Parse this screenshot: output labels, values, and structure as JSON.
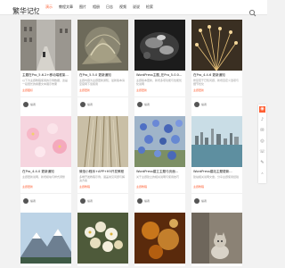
{
  "header": {
    "logo_text": "繁华记忆",
    "nav": [
      "演示",
      "教程文章",
      "图片",
      "相册",
      "日志",
      "视频",
      "说说",
      "检索"
    ],
    "active_index": 0
  },
  "colors": {
    "accent": "#ff5f33",
    "text": "#222222",
    "muted": "#999999",
    "background": "#f2f2f2"
  },
  "cards": [
    {
      "title": "主题在Pro_5.6.2+移动端框架...",
      "excerpt": "以下为主题教程使用的示例数据，这是一段很长的摘要文本展示效果",
      "tag": "主题图标",
      "author": "编者"
    },
    {
      "title": "在Pro_5.5.0 更新通知",
      "excerpt": "主题内容为主题更新通知，最新版本请至官网下载使用",
      "tag": "主题更新",
      "author": "编者"
    },
    {
      "title": "WordPress主题_在Pro_5.0.0...",
      "excerpt": "主题版本更新，新增多项功能与性能优化说明",
      "tag": "主题更新",
      "author": "编者"
    },
    {
      "title": "在Pro_4.4.6 更新通知",
      "excerpt": "修复若干已知问题，新增自定义选项与细节优化",
      "tag": "主题更新",
      "author": "编者"
    },
    {
      "title": "在Pro_4.4.0 更新通知",
      "excerpt": "主题更新说明，新增模块与样式调整",
      "tag": "主题更新",
      "author": "编者"
    },
    {
      "title": "微信小程序+APP+H5开发教程",
      "excerpt": "多端开发教程示例，涵盖常见问题与解决方案",
      "tag": "主题教程",
      "author": "编者"
    },
    {
      "title": "WordPress建立主题与页面...",
      "excerpt": "关于主题建立的相关说明与使用技巧",
      "tag": "主题教程",
      "author": "编者"
    },
    {
      "title": "WordPress建站主题更新...",
      "excerpt": "建站相关说明文章，分享主题使用经验",
      "tag": "主题教程",
      "author": "编者"
    },
    {
      "title": "",
      "excerpt": "",
      "tag": "",
      "author": ""
    },
    {
      "title": "",
      "excerpt": "",
      "tag": "",
      "author": ""
    },
    {
      "title": "",
      "excerpt": "",
      "tag": "",
      "author": ""
    },
    {
      "title": "",
      "excerpt": "",
      "tag": "",
      "author": ""
    }
  ],
  "sidebar": {
    "icons": [
      "location-icon",
      "qq-icon",
      "wechat-icon",
      "weibo-icon",
      "phone-icon",
      "mail-icon",
      "top-icon"
    ],
    "glyphs": [
      "◉",
      "♪",
      "✉",
      "◎",
      "☏",
      "✎",
      "⌃"
    ]
  }
}
